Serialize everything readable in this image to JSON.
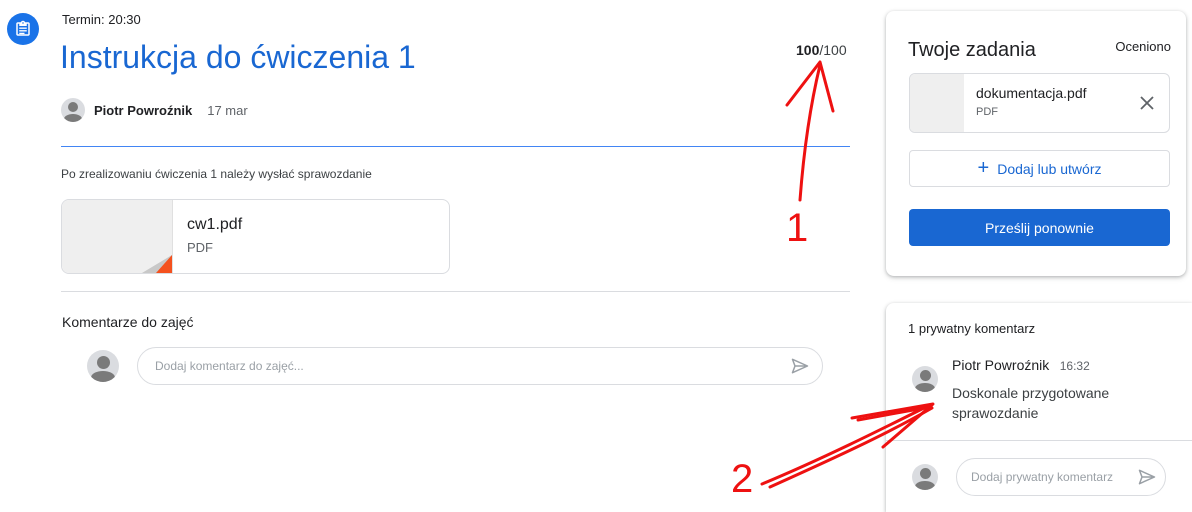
{
  "assignment": {
    "due": "Termin: 20:30",
    "title": "Instrukcja do ćwiczenia 1",
    "points_earned": "100",
    "points_total": "/100",
    "author": "Piotr Powroźnik",
    "date": "17 mar",
    "description": "Po zrealizowaniu ćwiczenia 1 należy wysłać sprawozdanie",
    "attachment": {
      "name": "cw1.pdf",
      "type": "PDF"
    }
  },
  "class_comments": {
    "heading": "Komentarze do zajęć",
    "placeholder": "Dodaj komentarz do zajęć..."
  },
  "your_work": {
    "title": "Twoje zadania",
    "status": "Oceniono",
    "file": {
      "name": "dokumentacja.pdf",
      "type": "PDF"
    },
    "add_label": "Dodaj lub utwórz",
    "resubmit_label": "Prześlij ponownie"
  },
  "private_comments": {
    "heading": "1 prywatny komentarz",
    "comment": {
      "author": "Piotr Powroźnik",
      "time": "16:32",
      "text": "Doskonale przygotowane sprawozdanie"
    },
    "placeholder": "Dodaj prywatny komentarz"
  },
  "annotations": {
    "label_1": "1",
    "label_2": "2",
    "color": "#ee1111"
  },
  "colors": {
    "accent": "#1967d2",
    "icon_bg": "#1a73e8",
    "divider_accent": "#4285f4",
    "pdf_corner": "#f4511e"
  },
  "icons": {
    "assignment": "assignment-icon",
    "send": "send-icon",
    "close": "close-icon",
    "plus": "plus-icon",
    "avatar": "person-avatar"
  }
}
